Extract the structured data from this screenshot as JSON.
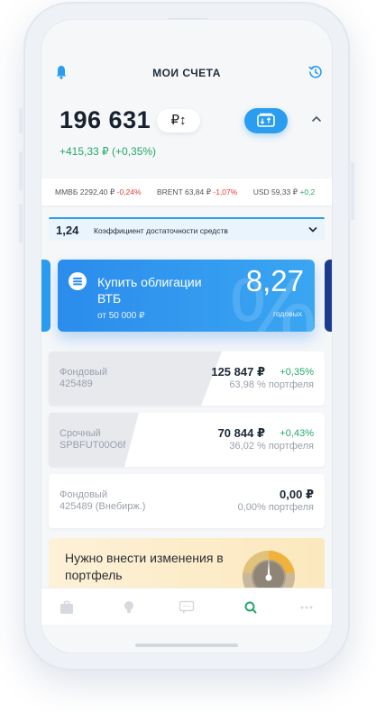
{
  "header": {
    "title": "МОИ СЧЕТА"
  },
  "balance": {
    "amount": "196 631",
    "currency_toggle": "₽↕",
    "change": "+415,33 ₽ (+0,35%)"
  },
  "ticker": [
    {
      "name": "ММВБ 2292,40 ₽",
      "change": "-0,24%",
      "dir": "neg"
    },
    {
      "name": "BRENT 63,84 ₽",
      "change": "-1,07%",
      "dir": "neg"
    },
    {
      "name": "USD 59,33 ₽",
      "change": "+0,2",
      "dir": "pos"
    }
  ],
  "ratio": {
    "value": "1,24",
    "label": "Коэффициент достаточности средств"
  },
  "promo": {
    "title": "Купить облигации ВТБ",
    "subtitle": "от 50 000 ₽",
    "rate": "8,27",
    "rate_label": "годовых",
    "bg_glyph": "%"
  },
  "accounts": [
    {
      "type": "Фондовый",
      "number": "425489",
      "amount": "125 847 ₽",
      "change": "+0,35%",
      "share": "63,98 % портфеля"
    },
    {
      "type": "Срочный",
      "number": "SPBFUT00O6f",
      "amount": "70 844 ₽",
      "change": "+0,43%",
      "share": "36,02 % портфеля"
    },
    {
      "type": "Фондовый",
      "number": "425489 (Внебирж.)",
      "amount": "0,00 ₽",
      "change": "",
      "share": "0,00% портфеля"
    }
  ],
  "banner": {
    "text": "Нужно внести изменения в портфель"
  },
  "colors": {
    "accent": "#2a9df0",
    "positive": "#23a96a",
    "negative": "#e53935",
    "promo_dark": "#1b3b8f"
  },
  "tabs": [
    {
      "icon": "briefcase-icon",
      "active": false
    },
    {
      "icon": "lightbulb-icon",
      "active": false
    },
    {
      "icon": "chat-icon",
      "active": false
    },
    {
      "icon": "search-icon",
      "active": true
    },
    {
      "icon": "more-icon",
      "active": false
    }
  ]
}
